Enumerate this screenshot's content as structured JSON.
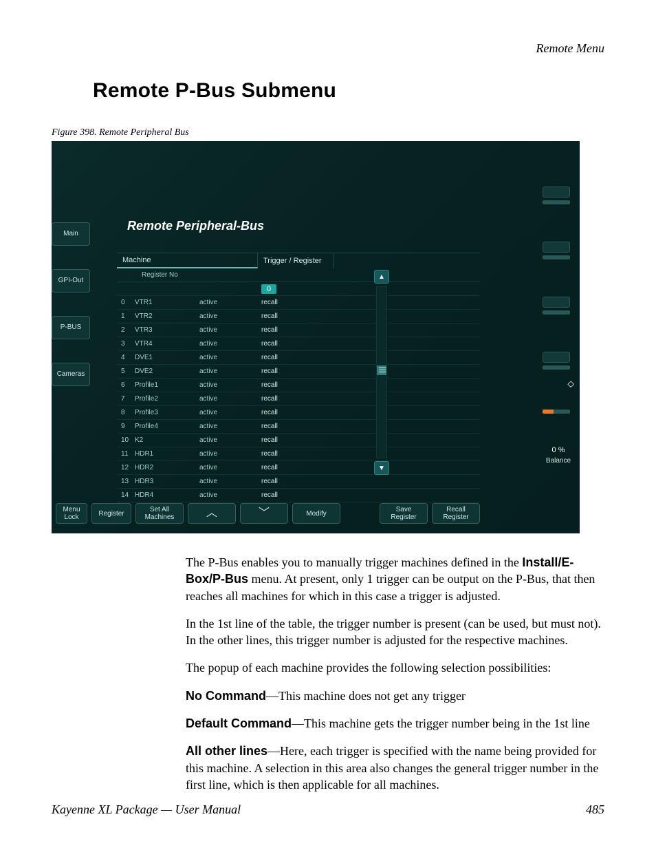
{
  "header": {
    "right": "Remote Menu"
  },
  "section_title": "Remote P-Bus Submenu",
  "figure_caption": "Figure 398.  Remote Peripheral Bus",
  "screenshot": {
    "panel_title": "Remote  Peripheral-Bus",
    "side_nav": [
      "Main",
      "GPI-Out",
      "P-BUS",
      "Cameras"
    ],
    "columns": {
      "machine": "Machine",
      "trigger": "Trigger / Register",
      "register_no": "Register No"
    },
    "first_row": {
      "idx": "",
      "name": "",
      "status": "",
      "trigger_value": "0"
    },
    "rows": [
      {
        "idx": "0",
        "name": "VTR1",
        "status": "active",
        "trigger": "recall",
        "selected": true
      },
      {
        "idx": "1",
        "name": "VTR2",
        "status": "active",
        "trigger": "recall",
        "selected": false
      },
      {
        "idx": "2",
        "name": "VTR3",
        "status": "active",
        "trigger": "recall",
        "selected": false
      },
      {
        "idx": "3",
        "name": "VTR4",
        "status": "active",
        "trigger": "recall",
        "selected": false
      },
      {
        "idx": "4",
        "name": "DVE1",
        "status": "active",
        "trigger": "recall",
        "selected": false
      },
      {
        "idx": "5",
        "name": "DVE2",
        "status": "active",
        "trigger": "recall",
        "selected": false
      },
      {
        "idx": "6",
        "name": "Profile1",
        "status": "active",
        "trigger": "recall",
        "selected": false
      },
      {
        "idx": "7",
        "name": "Profile2",
        "status": "active",
        "trigger": "recall",
        "selected": false
      },
      {
        "idx": "8",
        "name": "Profile3",
        "status": "active",
        "trigger": "recall",
        "selected": false
      },
      {
        "idx": "9",
        "name": "Profile4",
        "status": "active",
        "trigger": "recall",
        "selected": false
      },
      {
        "idx": "10",
        "name": "K2",
        "status": "active",
        "trigger": "recall",
        "selected": false
      },
      {
        "idx": "11",
        "name": "HDR1",
        "status": "active",
        "trigger": "recall",
        "selected": false
      },
      {
        "idx": "12",
        "name": "HDR2",
        "status": "active",
        "trigger": "recall",
        "selected": false
      },
      {
        "idx": "13",
        "name": "HDR3",
        "status": "active",
        "trigger": "recall",
        "selected": false
      },
      {
        "idx": "14",
        "name": "HDR4",
        "status": "active",
        "trigger": "recall",
        "selected": false
      }
    ],
    "bottom_bar": {
      "menu_lock": "Menu\nLock",
      "register": "Register",
      "set_all": "Set All\nMachines",
      "modify": "Modify",
      "save_register": "Save\nRegister",
      "recall_register": "Recall\nRegister"
    },
    "right_panel": {
      "percent": "0 %",
      "balance": "Balance"
    }
  },
  "body": {
    "p1a": "The P-Bus enables you to manually trigger machines defined in the ",
    "p1b": "Install/E-Box/P-Bus",
    "p1c": " menu. At present, only 1 trigger can be output on the P-Bus, that then reaches all machines for which in this case a trigger is adjusted.",
    "p2": "In the 1st line of the table, the trigger number is present (can be used, but must not). In the other lines, this trigger number is adjusted for the respective machines.",
    "p3": "The popup of each machine provides the following selection possibilities:",
    "p4a": "No Command",
    "p4b": "—This machine does not get any trigger",
    "p5a": "Default Command",
    "p5b": "—This machine gets the trigger number being in the 1st line",
    "p6a": "All other lines",
    "p6b": "—Here, each trigger is specified with the name being provided for this machine. A selection in this area also changes the general trigger number in the first line, which is then applicable for all machines."
  },
  "footer": {
    "left": "Kayenne XL Package — User Manual",
    "right": "485"
  }
}
